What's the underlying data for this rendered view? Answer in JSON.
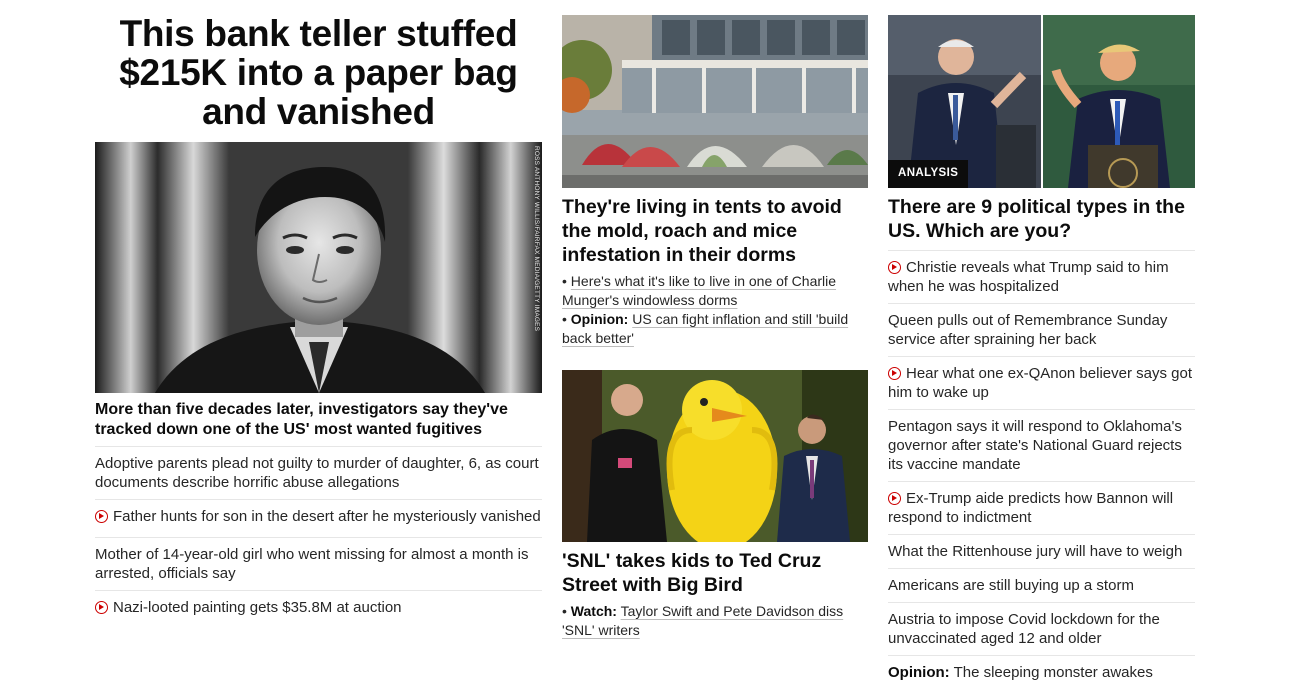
{
  "left": {
    "headline": "This bank teller stuffed $215K into a paper bag and vanished",
    "photo_credit": "ROSS ANTHONY WILLIS/FAIRFAX MEDIA/GETTY IMAGES",
    "subheadline": "More than five decades later, investigators say they've tracked down one of the US' most wanted fugitives",
    "links": [
      {
        "text": "Adoptive parents plead not guilty to murder of daughter, 6, as court documents describe horrific abuse allegations",
        "video": false
      },
      {
        "text": "Father hunts for son in the desert after he mysteriously vanished",
        "video": true
      },
      {
        "text": "Mother of 14-year-old girl who went missing for almost a month is arrested, officials say",
        "video": false
      },
      {
        "text": "Nazi-looted painting gets $35.8M at auction",
        "video": true
      }
    ]
  },
  "middle": {
    "story1": {
      "headline": "They're living in tents to avoid the mold, roach and mice infestation in their dorms",
      "bullets": [
        {
          "prefix": "",
          "text": "Here's what it's like to live in one of Charlie Munger's windowless dorms"
        },
        {
          "prefix": "Opinion:",
          "text": "US can fight inflation and still 'build back better'"
        }
      ]
    },
    "story2": {
      "headline": "'SNL' takes kids to Ted Cruz Street with Big Bird",
      "bullets": [
        {
          "prefix": "Watch:",
          "text": "Taylor Swift and Pete Davidson diss 'SNL' writers"
        }
      ]
    }
  },
  "right": {
    "badge": "ANALYSIS",
    "headline": "There are 9 political types in the US. Which are you?",
    "links": [
      {
        "text": "Christie reveals what Trump said to him when he was hospitalized",
        "video": true,
        "prefix": ""
      },
      {
        "text": "Queen pulls out of Remembrance Sunday service after spraining her back",
        "video": false,
        "prefix": ""
      },
      {
        "text": "Hear what one ex-QAnon believer says got him to wake up",
        "video": true,
        "prefix": ""
      },
      {
        "text": "Pentagon says it will respond to Oklahoma's governor after state's National Guard rejects its vaccine mandate",
        "video": false,
        "prefix": ""
      },
      {
        "text": "Ex-Trump aide predicts how Bannon will respond to indictment",
        "video": true,
        "prefix": ""
      },
      {
        "text": "What the Rittenhouse jury will have to weigh",
        "video": false,
        "prefix": ""
      },
      {
        "text": "Americans are still buying up a storm",
        "video": false,
        "prefix": ""
      },
      {
        "text": "Austria to impose Covid lockdown for the unvaccinated aged 12 and older",
        "video": false,
        "prefix": ""
      },
      {
        "text": "The sleeping monster awakes",
        "video": false,
        "prefix": "Opinion:"
      }
    ]
  },
  "colors": {
    "headline_text": "#0c0c0c",
    "body_text": "#262626",
    "divider": "#e6e6e6",
    "video_icon": "#cc0000",
    "badge_bg": "#0c0c0c"
  }
}
